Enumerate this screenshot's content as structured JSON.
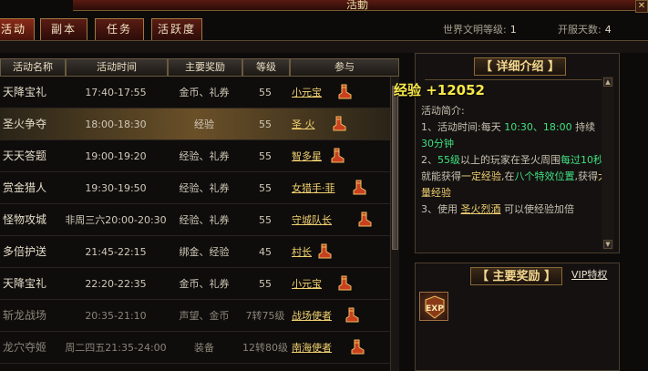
{
  "title": "活動",
  "tabs": [
    {
      "label": "活动",
      "active": true
    },
    {
      "label": "副本",
      "active": false
    },
    {
      "label": "任务",
      "active": false
    },
    {
      "label": "活跃度",
      "active": false
    }
  ],
  "header": {
    "world_level_label": "世界文明等级:",
    "world_level_value": "1",
    "server_days_label": "开服天数:",
    "server_days_value": "4"
  },
  "table": {
    "columns": [
      "活动名称",
      "活动时间",
      "主要奖励",
      "等级",
      "参与"
    ],
    "rows": [
      {
        "name": "天降宝礼",
        "time": "17:40-17:55",
        "reward": "金币、礼券",
        "level": "55",
        "npc": "小元宝",
        "highlight": false,
        "dim": false
      },
      {
        "name": "圣火争夺",
        "time": "18:00-18:30",
        "reward": "经验",
        "level": "55",
        "npc": "圣 火",
        "highlight": true,
        "dim": false
      },
      {
        "name": "天天答题",
        "time": "19:00-19:20",
        "reward": "经验、礼券",
        "level": "55",
        "npc": "智多星",
        "highlight": false,
        "dim": false
      },
      {
        "name": "赏金猎人",
        "time": "19:30-19:50",
        "reward": "经验、礼券",
        "level": "55",
        "npc": "女猎手·菲",
        "highlight": false,
        "dim": false
      },
      {
        "name": "怪物攻城",
        "time": "非周三六20:00-20:30",
        "reward": "经验、礼券",
        "level": "55",
        "npc": "守城队长",
        "highlight": false,
        "dim": false
      },
      {
        "name": "多倍护送",
        "time": "21:45-22:15",
        "reward": "绑金、经验",
        "level": "45",
        "npc": "村长",
        "highlight": false,
        "dim": false
      },
      {
        "name": "天降宝礼",
        "time": "22:20-22:35",
        "reward": "金币、礼券",
        "level": "55",
        "npc": "小元宝",
        "highlight": false,
        "dim": false
      },
      {
        "name": "斩龙战场",
        "time": "20:35-21:10",
        "reward": "声望、金币",
        "level": "7转75级",
        "npc": "战场使者",
        "highlight": false,
        "dim": true
      },
      {
        "name": "龙穴夺姬",
        "time": "周二四五21:35-24:00",
        "reward": "装备",
        "level": "12转80级",
        "npc": "南海使者",
        "highlight": false,
        "dim": true
      }
    ]
  },
  "detail": {
    "title": "详细介绍",
    "exp_popup": "经验 +12052",
    "intro_heading": "活动简介:",
    "line1_prefix": "1、活动时间:每天 ",
    "line1_times": "10:30、18:00",
    "line1_suffix": " 持续",
    "line1_duration": "30分钟",
    "line2_prefix": "2、",
    "line2_level": "55级",
    "line2_mid1": "以上的玩家在圣火周围",
    "line2_interval": "每过10秒",
    "line2_mid2": "就能获得",
    "line2_exp": "一定经验",
    "line2_mid3": ",在",
    "line2_pos": "八个特效位置",
    "line2_mid4": ",获得",
    "line2_big": "大量经验",
    "line3_prefix": "3、使用 ",
    "line3_item": "圣火烈酒",
    "line3_suffix": " 可以使经验加倍"
  },
  "rewards": {
    "title": "主要奖励",
    "vip_label": "VIP特权",
    "item_label": "EXP"
  },
  "colors": {
    "highlight": "#6a5028",
    "npc_link": "#f0d070",
    "green_text": "#40e080",
    "exp_popup": "#f8e848"
  }
}
